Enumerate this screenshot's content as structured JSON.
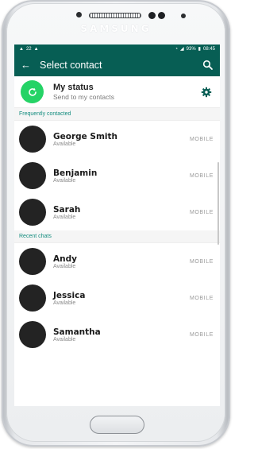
{
  "device": {
    "brand": "SAMSUNG"
  },
  "statusbar": {
    "left_icons": [
      "notification-icon",
      "notification-icon"
    ],
    "left_text": "22",
    "signal_text": "93%",
    "time": "08:45"
  },
  "appbar": {
    "title": "Select contact",
    "back_icon": "arrow-left-icon",
    "search_icon": "search-icon"
  },
  "my_status": {
    "title": "My status",
    "subtitle": "Send to my contacts",
    "settings_icon": "gear-icon"
  },
  "sections": [
    {
      "header": "Frequently contacted",
      "contacts": [
        {
          "name": "George Smith",
          "status": "Available",
          "type": "MOBILE"
        },
        {
          "name": "Benjamin",
          "status": "Available",
          "type": "MOBILE"
        },
        {
          "name": "Sarah",
          "status": "Available",
          "type": "MOBILE"
        }
      ]
    },
    {
      "header": "Recent chats",
      "contacts": [
        {
          "name": "Andy",
          "status": "Available",
          "type": "MOBILE"
        },
        {
          "name": "Jessica",
          "status": "Available",
          "type": "MOBILE"
        },
        {
          "name": "Samantha",
          "status": "Available",
          "type": "MOBILE"
        }
      ]
    }
  ],
  "colors": {
    "primary": "#075e54",
    "accent": "#25d366",
    "section_text": "#128c7e"
  }
}
